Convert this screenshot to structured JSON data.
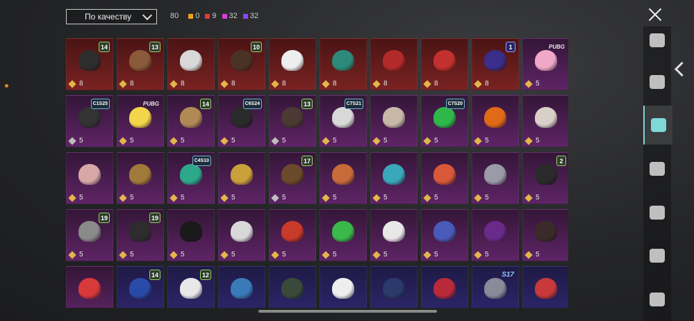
{
  "sort": {
    "label": "По качеству"
  },
  "counts": {
    "total": "80",
    "orange": "0",
    "red": "9",
    "magenta": "32",
    "purple": "32"
  },
  "colors": {
    "orange": "#e8a21e",
    "red": "#e23a3a",
    "magenta": "#d63fd6",
    "purple": "#8a46ff",
    "accent": "#7fd7d7"
  },
  "items": [
    {
      "q": "red",
      "pts": "8",
      "badge": "14",
      "btype": "num",
      "ic": "#2d2d2d"
    },
    {
      "q": "red",
      "pts": "8",
      "badge": "13",
      "btype": "num",
      "ic": "#8a5a3a"
    },
    {
      "q": "red",
      "pts": "8",
      "badge": "",
      "btype": "",
      "ic": "#d8d8d8"
    },
    {
      "q": "red",
      "pts": "8",
      "badge": "10",
      "btype": "num",
      "ic": "#4a3326"
    },
    {
      "q": "red",
      "pts": "8",
      "badge": "",
      "btype": "",
      "ic": "#eeeeee"
    },
    {
      "q": "red",
      "pts": "8",
      "badge": "",
      "btype": "",
      "ic": "#2c8a7a"
    },
    {
      "q": "red",
      "pts": "8",
      "badge": "",
      "btype": "",
      "ic": "#b32a2a"
    },
    {
      "q": "red",
      "pts": "8",
      "badge": "",
      "btype": "",
      "ic": "#c23030"
    },
    {
      "q": "red",
      "pts": "8",
      "badge": "1",
      "btype": "blue",
      "ic": "#3a2e8a"
    },
    {
      "q": "mag",
      "pts": "5",
      "badge": "PUBG",
      "btype": "pubg",
      "ic": "#f0a8c8"
    },
    {
      "q": "mag",
      "pts": "5",
      "badge": "C1S25",
      "btype": "season",
      "ic": "#333333",
      "grey": true
    },
    {
      "q": "mag",
      "pts": "5",
      "badge": "PUBG",
      "btype": "pubg",
      "ic": "#f2d54a"
    },
    {
      "q": "mag",
      "pts": "5",
      "badge": "14",
      "btype": "num",
      "ic": "#b08a55"
    },
    {
      "q": "mag",
      "pts": "5",
      "badge": "C6S24",
      "btype": "season",
      "ic": "#2a2a2a"
    },
    {
      "q": "mag",
      "pts": "5",
      "badge": "13",
      "btype": "num",
      "ic": "#4a3a33",
      "grey": true
    },
    {
      "q": "mag",
      "pts": "5",
      "badge": "C7S21",
      "btype": "season",
      "ic": "#d8d8d8"
    },
    {
      "q": "mag",
      "pts": "5",
      "badge": "",
      "btype": "",
      "ic": "#c8b8a8"
    },
    {
      "q": "mag",
      "pts": "5",
      "badge": "C7S20",
      "btype": "season",
      "ic": "#2fb84a"
    },
    {
      "q": "mag",
      "pts": "5",
      "badge": "",
      "btype": "",
      "ic": "#e06a18"
    },
    {
      "q": "mag",
      "pts": "5",
      "badge": "",
      "btype": "",
      "ic": "#d8d0c8"
    },
    {
      "q": "mag",
      "pts": "5",
      "badge": "",
      "btype": "",
      "ic": "#d8a8a8"
    },
    {
      "q": "mag",
      "pts": "5",
      "badge": "",
      "btype": "",
      "ic": "#a07a3a"
    },
    {
      "q": "mag",
      "pts": "5",
      "badge": "C4S10",
      "btype": "season",
      "ic": "#2ea88a"
    },
    {
      "q": "mag",
      "pts": "5",
      "badge": "",
      "btype": "",
      "ic": "#c9a03a"
    },
    {
      "q": "mag",
      "pts": "5",
      "badge": "17",
      "btype": "num",
      "ic": "#6a4a2a",
      "grey": true
    },
    {
      "q": "mag",
      "pts": "5",
      "badge": "",
      "btype": "",
      "ic": "#c86a3a"
    },
    {
      "q": "mag",
      "pts": "5",
      "badge": "",
      "btype": "",
      "ic": "#3aa8b8"
    },
    {
      "q": "mag",
      "pts": "5",
      "badge": "",
      "btype": "",
      "ic": "#d8583a"
    },
    {
      "q": "mag",
      "pts": "5",
      "badge": "",
      "btype": "",
      "ic": "#9a9aa8"
    },
    {
      "q": "mag",
      "pts": "5",
      "badge": "2",
      "btype": "num",
      "ic": "#2a2a2a"
    },
    {
      "q": "mag",
      "pts": "5",
      "badge": "19",
      "btype": "num",
      "ic": "#8a8a8a"
    },
    {
      "q": "mag",
      "pts": "5",
      "badge": "19",
      "btype": "num",
      "ic": "#2d2d2d"
    },
    {
      "q": "mag",
      "pts": "5",
      "badge": "",
      "btype": "",
      "ic": "#1a1a1a"
    },
    {
      "q": "mag",
      "pts": "5",
      "badge": "",
      "btype": "",
      "ic": "#d8d8d8"
    },
    {
      "q": "mag",
      "pts": "5",
      "badge": "",
      "btype": "",
      "ic": "#c83a2a"
    },
    {
      "q": "mag",
      "pts": "5",
      "badge": "",
      "btype": "",
      "ic": "#3ab84a"
    },
    {
      "q": "mag",
      "pts": "5",
      "badge": "",
      "btype": "",
      "ic": "#e8e8e8"
    },
    {
      "q": "mag",
      "pts": "5",
      "badge": "",
      "btype": "",
      "ic": "#4a5ab8"
    },
    {
      "q": "mag",
      "pts": "5",
      "badge": "",
      "btype": "",
      "ic": "#6a2a8a"
    },
    {
      "q": "mag",
      "pts": "5",
      "badge": "",
      "btype": "",
      "ic": "#3a2a2a"
    },
    {
      "q": "mag",
      "pts": "",
      "badge": "",
      "btype": "",
      "ic": "#d83a3a"
    },
    {
      "q": "pur",
      "pts": "",
      "badge": "14",
      "btype": "num",
      "ic": "#2a4aa8"
    },
    {
      "q": "pur",
      "pts": "",
      "badge": "12",
      "btype": "num",
      "ic": "#e8e8e8"
    },
    {
      "q": "pur",
      "pts": "",
      "badge": "",
      "btype": "",
      "ic": "#3a7ab8"
    },
    {
      "q": "pur",
      "pts": "",
      "badge": "",
      "btype": "",
      "ic": "#3a4a3a"
    },
    {
      "q": "pur",
      "pts": "",
      "badge": "",
      "btype": "",
      "ic": "#eeeeee"
    },
    {
      "q": "pur",
      "pts": "",
      "badge": "",
      "btype": "",
      "ic": "#2a3a6a"
    },
    {
      "q": "pur",
      "pts": "",
      "badge": "",
      "btype": "",
      "ic": "#b82a3a"
    },
    {
      "q": "pur",
      "pts": "",
      "badge": "S17",
      "btype": "s17",
      "ic": "#8a8a9a"
    },
    {
      "q": "pur",
      "pts": "",
      "badge": "",
      "btype": "",
      "ic": "#c83a3a"
    }
  ],
  "sidebar": [
    {
      "icon": "shirt-icon",
      "active": false
    },
    {
      "icon": "helmet-icon",
      "active": false
    },
    {
      "icon": "cap-icon",
      "active": true
    },
    {
      "icon": "glasses-icon",
      "active": false
    },
    {
      "icon": "mask-icon",
      "active": false
    },
    {
      "icon": "jacket-icon",
      "active": false
    },
    {
      "icon": "face-icon",
      "active": false
    }
  ]
}
